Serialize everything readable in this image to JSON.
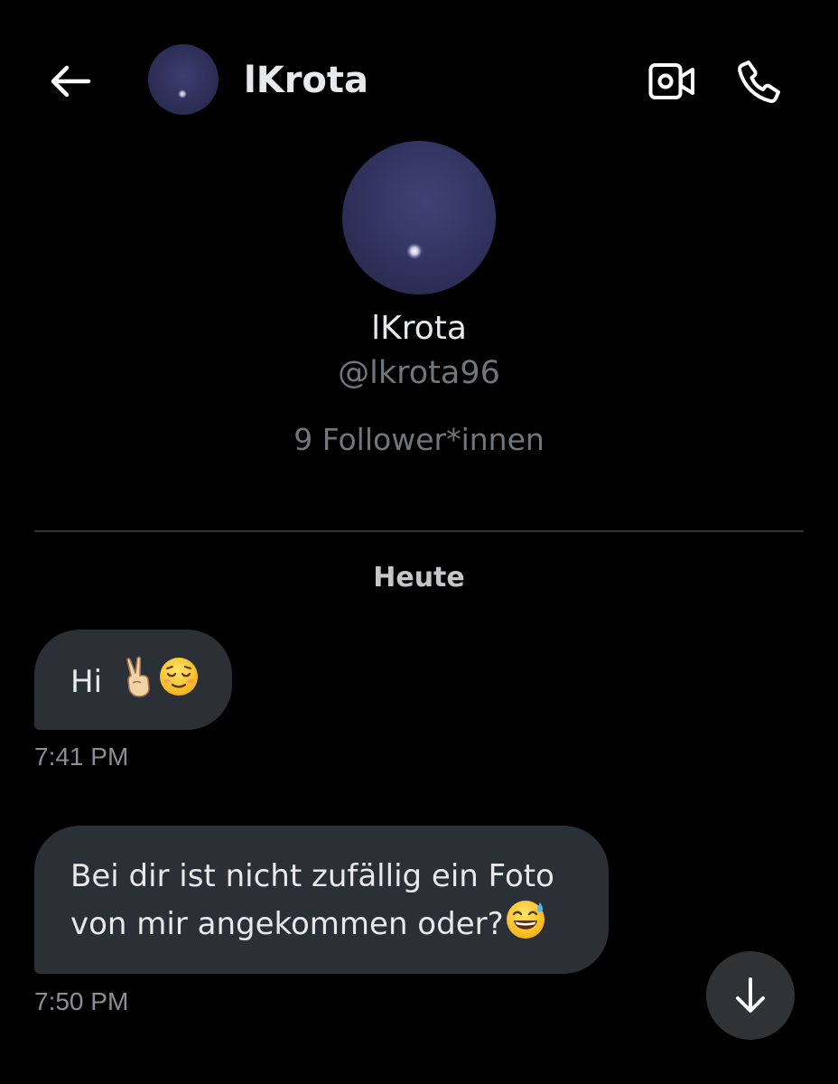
{
  "header": {
    "title": "lKrota",
    "icons": {
      "back": "arrow-left-icon",
      "video": "video-camera-icon",
      "call": "phone-icon"
    }
  },
  "profile": {
    "name": "lKrota",
    "handle": "@lkrota96",
    "followers": "9 Follower*innen"
  },
  "conversation": {
    "date_separator": "Heute",
    "messages": [
      {
        "text": "Hi",
        "emojis": [
          "victory-hand-emoji",
          "relieved-face-emoji"
        ],
        "time": "7:41 PM"
      },
      {
        "text": "Bei dir ist nicht zufällig ein Foto von mir angekommen oder?",
        "emojis": [
          "grinning-sweat-emoji"
        ],
        "time": "7:50 PM"
      }
    ]
  },
  "colors": {
    "background": "#000000",
    "bubble": "#2a3035",
    "text_primary": "#e7e9ea",
    "text_secondary": "#71767b",
    "divider": "#2f3336"
  }
}
